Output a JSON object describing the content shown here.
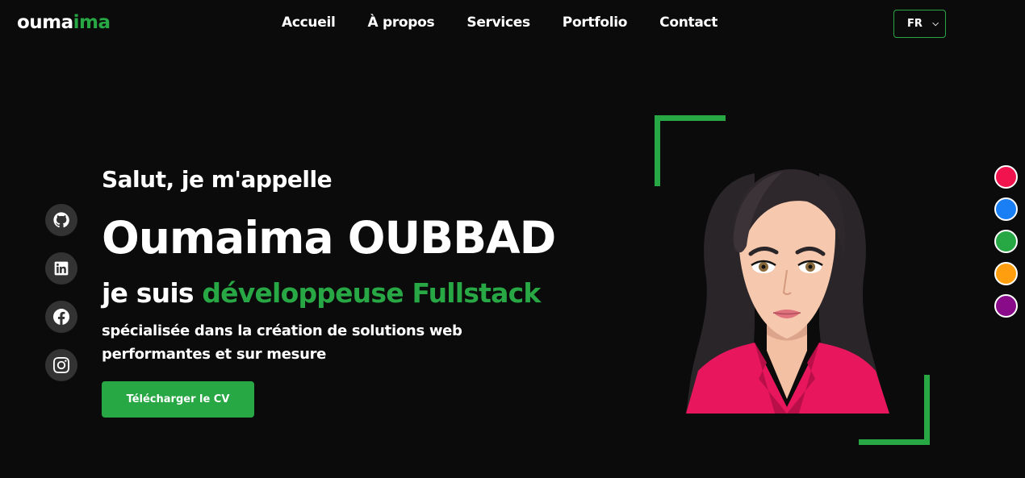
{
  "header": {
    "logo_part1": "ouma",
    "logo_part2": "ima",
    "nav": [
      "Accueil",
      "À propos",
      "Services",
      "Portfolio",
      "Contact"
    ],
    "lang": "FR"
  },
  "social": [
    "github-icon",
    "linkedin-icon",
    "facebook-icon",
    "instagram-icon"
  ],
  "hero": {
    "greeting": "Salut, je m'appelle",
    "name": "Oumaima OUBBAD",
    "role_prefix": "je suis ",
    "role_highlight": "développeuse Fullstack",
    "description": "spécialisée dans la création de solutions web performantes et sur mesure",
    "cv_button": "Télécharger le CV"
  },
  "theme_colors": [
    "#f0134d",
    "#1a7ff5",
    "#28a745",
    "#ff9f0f",
    "#8a0b8a"
  ],
  "accent": "#28a745"
}
